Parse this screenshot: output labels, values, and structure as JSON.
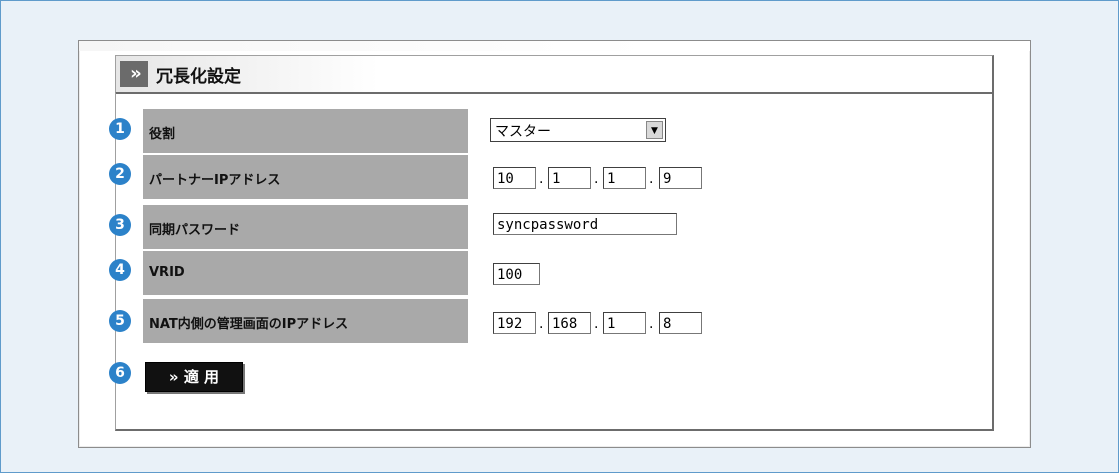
{
  "title": "冗長化設定",
  "title_chevron": "»",
  "rows": [
    {
      "num": "1",
      "label": "役割"
    },
    {
      "num": "2",
      "label": "パートナーIPアドレス"
    },
    {
      "num": "3",
      "label": "同期パスワード"
    },
    {
      "num": "4",
      "label": "VRID"
    },
    {
      "num": "5",
      "label": "NAT内側の管理画面のIPアドレス"
    }
  ],
  "role_select": {
    "value": "マスター",
    "arrow": "▼"
  },
  "partner_ip": [
    "10",
    "1",
    "1",
    "9"
  ],
  "sync_password": "syncpassword",
  "vrid": "100",
  "nat_ip": [
    "192",
    "168",
    "1",
    "8"
  ],
  "apply": {
    "num": "6",
    "label": "» 適 用"
  },
  "ip_dot": "."
}
